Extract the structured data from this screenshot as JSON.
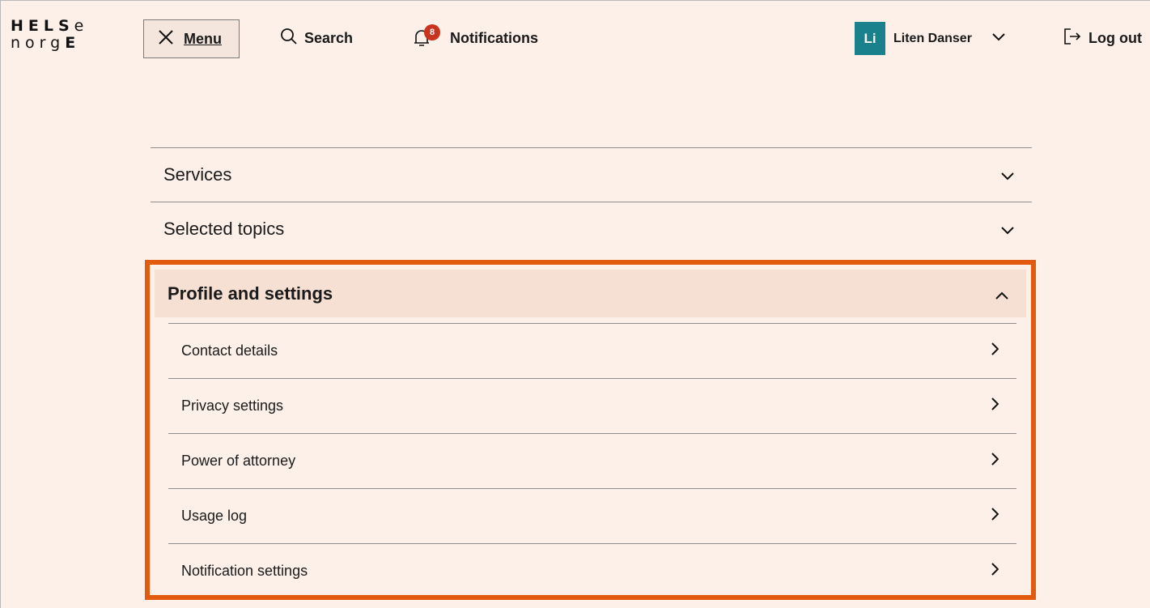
{
  "logo": {
    "line1": "HELSe",
    "line2": "norgE"
  },
  "header": {
    "menu_label": "Menu",
    "search_label": "Search",
    "notifications_label": "Notifications",
    "notifications_count": "8",
    "user_initials": "Li",
    "user_name": "Liten Danser",
    "logout_label": "Log out"
  },
  "menu": {
    "sections": [
      {
        "label": "Services"
      },
      {
        "label": "Selected topics"
      }
    ],
    "open_section": {
      "label": "Profile and settings",
      "items": [
        {
          "label": "Contact details"
        },
        {
          "label": "Privacy settings"
        },
        {
          "label": "Power of attorney"
        },
        {
          "label": "Usage log"
        },
        {
          "label": "Notification settings"
        }
      ]
    }
  },
  "colors": {
    "background": "#fdf0e8",
    "highlight_border": "#e25a0e",
    "avatar": "#18818b",
    "badge": "#c9341e"
  }
}
